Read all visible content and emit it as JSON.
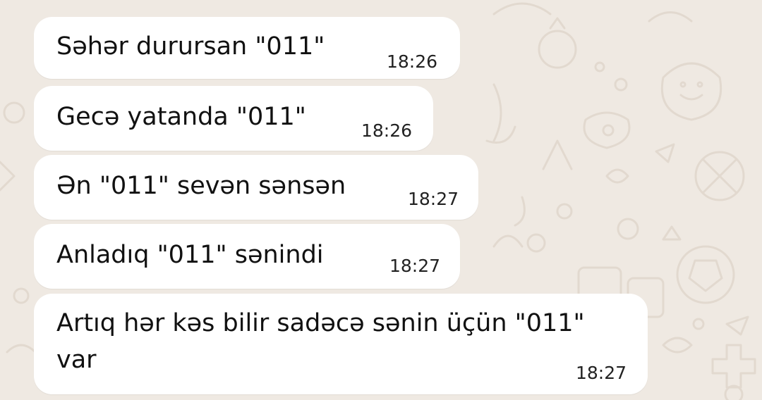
{
  "chat": {
    "messages": [
      {
        "text": "Səhər durursan \"011\"",
        "time": "18:26"
      },
      {
        "text": "Gecə yatanda \"011\"",
        "time": "18:26"
      },
      {
        "text": "Ən \"011\" sevən sənsən",
        "time": "18:27"
      },
      {
        "text": "Anladıq \"011\" sənindi",
        "time": "18:27"
      },
      {
        "text": "Artıq hər kəs bilir sadəcə sənin üçün \"011\" var",
        "time": "18:27"
      }
    ]
  },
  "colors": {
    "background": "#efe9e2",
    "bubble": "#ffffff",
    "doodle": "#e2dad1"
  }
}
